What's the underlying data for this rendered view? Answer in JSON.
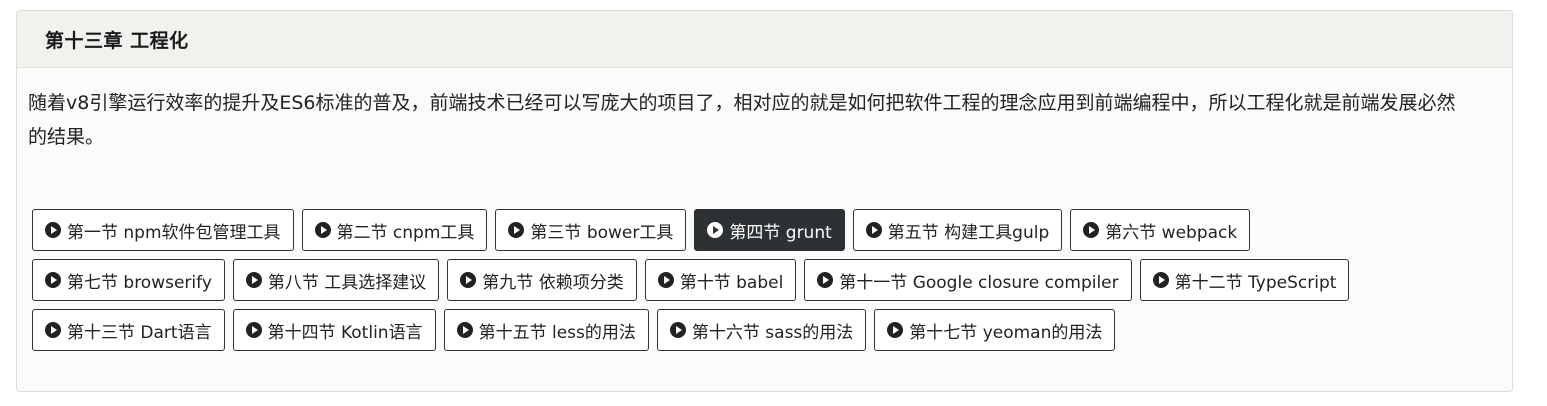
{
  "chapter": {
    "title": "第十三章 工程化",
    "description": "随着v8引擎运行效率的提升及ES6标准的普及，前端技术已经可以写庞大的项目了，相对应的就是如何把软件工程的理念应用到前端编程中，所以工程化就是前端发展必然的结果。"
  },
  "accent": {
    "active_bg": "#2e3133",
    "border": "#333333"
  },
  "sections": {
    "row1": [
      {
        "label": "第一节 npm软件包管理工具",
        "icon": "play-circle-icon"
      },
      {
        "label": "第二节 cnpm工具",
        "icon": "play-circle-icon"
      },
      {
        "label": "第三节 bower工具",
        "icon": "play-circle-icon"
      },
      {
        "label": "第四节 grunt",
        "icon": "play-circle-icon",
        "active": true
      },
      {
        "label": "第五节 构建工具gulp",
        "icon": "play-circle-icon"
      },
      {
        "label": "第六节 webpack",
        "icon": "play-circle-icon"
      }
    ],
    "row2": [
      {
        "label": "第七节 browserify",
        "icon": "play-circle-icon"
      },
      {
        "label": "第八节 工具选择建议",
        "icon": "play-circle-icon"
      },
      {
        "label": "第九节 依赖项分类",
        "icon": "play-circle-icon"
      },
      {
        "label": "第十节 babel",
        "icon": "play-circle-icon"
      },
      {
        "label": "第十一节 Google closure compiler",
        "icon": "play-circle-icon"
      },
      {
        "label": "第十二节 TypeScript",
        "icon": "play-circle-icon"
      }
    ],
    "row3": [
      {
        "label": "第十三节 Dart语言",
        "icon": "play-circle-icon"
      },
      {
        "label": "第十四节 Kotlin语言",
        "icon": "play-circle-icon"
      },
      {
        "label": "第十五节 less的用法",
        "icon": "play-circle-icon"
      },
      {
        "label": "第十六节 sass的用法",
        "icon": "play-circle-icon"
      },
      {
        "label": "第十七节 yeoman的用法",
        "icon": "play-circle-icon"
      }
    ]
  }
}
